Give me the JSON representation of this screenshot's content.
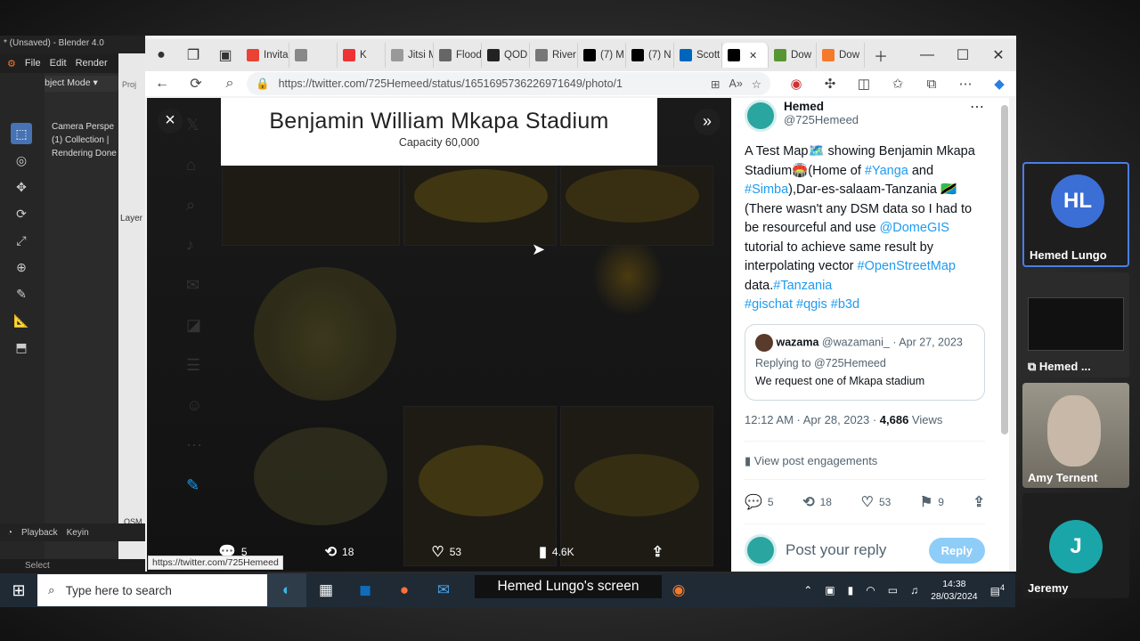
{
  "blender": {
    "title": "* (Unsaved) - Blender 4.0",
    "menu": [
      "File",
      "Edit",
      "Render"
    ],
    "mode": "Object Mode",
    "panel_lines": [
      "Camera Perspe",
      "(1) Collection |",
      "Rendering Done"
    ],
    "layer": "Layer",
    "playback": "Playback",
    "keying": "Keyin",
    "status": "Select",
    "strip_label": "Proj",
    "osm_label": "OSM"
  },
  "browser": {
    "tabs": [
      {
        "label": "Invita",
        "icon": "gmail-icon",
        "color": "#ea4335"
      },
      {
        "label": "",
        "icon": "feather-icon",
        "color": "#888"
      },
      {
        "label": "K",
        "icon": "record-icon",
        "color": "#e33"
      },
      {
        "label": "Jitsi M",
        "icon": "doc-icon",
        "color": "#999"
      },
      {
        "label": "Flood",
        "icon": "grid-icon",
        "color": "#666"
      },
      {
        "label": "QOD",
        "icon": "github-icon",
        "color": "#222"
      },
      {
        "label": "River",
        "icon": "wiki-icon",
        "color": "#777"
      },
      {
        "label": "(7) M",
        "icon": "x-icon",
        "color": "#000"
      },
      {
        "label": "(7) N",
        "icon": "x-icon",
        "color": "#000"
      },
      {
        "label": "Scott",
        "icon": "saltire-icon",
        "color": "#0065bd"
      },
      {
        "label": "",
        "icon": "x-icon",
        "color": "#000",
        "active": true
      },
      {
        "label": "Dow",
        "icon": "qgis-icon",
        "color": "#589632"
      },
      {
        "label": "Dow",
        "icon": "blender-icon",
        "color": "#f5792a"
      }
    ],
    "url": "https://twitter.com/725Hemeed/status/1651695736226971649/photo/1",
    "hover_url": "https://twitter.com/725Hemeed"
  },
  "viewer": {
    "map_title": "Benjamin William Mkapa Stadium",
    "map_subtitle": "Capacity 60,000",
    "replies": "5",
    "reposts": "18",
    "likes": "53",
    "views": "4.6K"
  },
  "tweet": {
    "name": "Hemed",
    "handle": "@725Hemeed",
    "text_parts": {
      "p1": "A Test Map🗺️ showing Benjamin Mkapa Stadium🏟️(Home of ",
      "yanga": "#Yanga",
      "p2": " and ",
      "simba": "#Simba",
      "p3": "),Dar-es-salaam-Tanzania 🇹🇿(There wasn't any DSM data so I had to be resourceful and use ",
      "domegis": "@DomeGIS",
      "p4": "  tutorial to achieve same result by interpolating vector ",
      "osm": "#OpenStreetMap",
      "p5": " data.",
      "tanzania": "#Tanzania",
      "gischat": "#gischat",
      "qgis": "#qgis",
      "b3d": "#b3d"
    },
    "quote": {
      "name": "wazama",
      "handle": "@wazamani_",
      "date": "· Apr 27, 2023",
      "replying": "Replying to @725Hemeed",
      "text": "We request one of Mkapa stadium"
    },
    "time": "12:12 AM · Apr 28, 2023 · ",
    "views_count": "4,686",
    "views_label": " Views",
    "engagements": "View post engagements",
    "replies": "5",
    "reposts": "18",
    "likes": "53",
    "bookmarks": "9",
    "reply_placeholder": "Post your reply",
    "reply_button": "Reply"
  },
  "taskbar": {
    "search_placeholder": "Type here to search",
    "screen_share_label": "Hemed Lungo's screen",
    "time": "14:38",
    "date": "28/03/2024",
    "notifications": "4"
  },
  "participants": [
    {
      "name": "Hemed Lungo",
      "initials": "HL",
      "color": "#3b6fd6"
    },
    {
      "name": "Hemed ...",
      "initials": "",
      "color": "#222"
    },
    {
      "name": "Amy Ternent",
      "initials": "",
      "color": "#8a8a80"
    },
    {
      "name": "Jeremy",
      "initials": "J",
      "color": "#1aa6a8"
    }
  ]
}
